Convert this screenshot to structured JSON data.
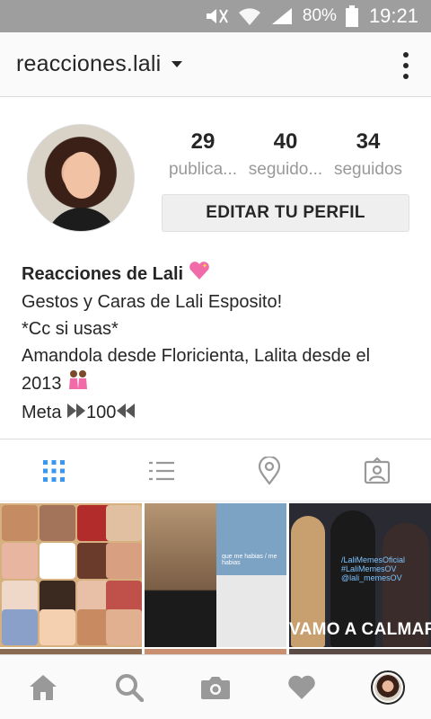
{
  "status_bar": {
    "battery": "80%",
    "time": "19:21",
    "icons": [
      "mute-icon",
      "wifi-icon",
      "signal-icon",
      "battery-icon"
    ]
  },
  "header": {
    "username": "reacciones.lali",
    "dropdown_icon": "chevron-down-icon",
    "menu_icon": "more-vert-icon"
  },
  "profile": {
    "stats": [
      {
        "value": "29",
        "label": "publica..."
      },
      {
        "value": "40",
        "label": "seguido..."
      },
      {
        "value": "34",
        "label": "seguidos"
      }
    ],
    "edit_button": "EDITAR TU PERFIL"
  },
  "bio": {
    "name": "Reacciones de Lali",
    "line1": "Gestos y Caras de Lali Esposito!",
    "line2": "*Cc si usas*",
    "line3": "Amandola desde Floricienta, Lalita desde el",
    "line4": "2013",
    "line5_prefix": "Meta",
    "line5_value": "100"
  },
  "tabs": [
    {
      "name": "grid-icon",
      "active": true
    },
    {
      "name": "list-icon",
      "active": false
    },
    {
      "name": "location-pin-icon",
      "active": false
    },
    {
      "name": "tagged-photos-icon",
      "active": false
    }
  ],
  "grid_posts": {
    "banner_text": "VAMO A CALMARNO",
    "watermark_lines": [
      "/LaliMemesOficial",
      "#LaliMemesOV",
      "@lali_memesOV"
    ],
    "caption": "que me habias / me habias"
  },
  "bottom_nav": [
    "home-icon",
    "search-icon",
    "camera-icon",
    "heart-icon",
    "profile-avatar"
  ],
  "colors": {
    "status_bar": "#9e9e9e",
    "active_tab": "#3897f0",
    "inactive_icon": "#999999",
    "text": "#262626"
  }
}
